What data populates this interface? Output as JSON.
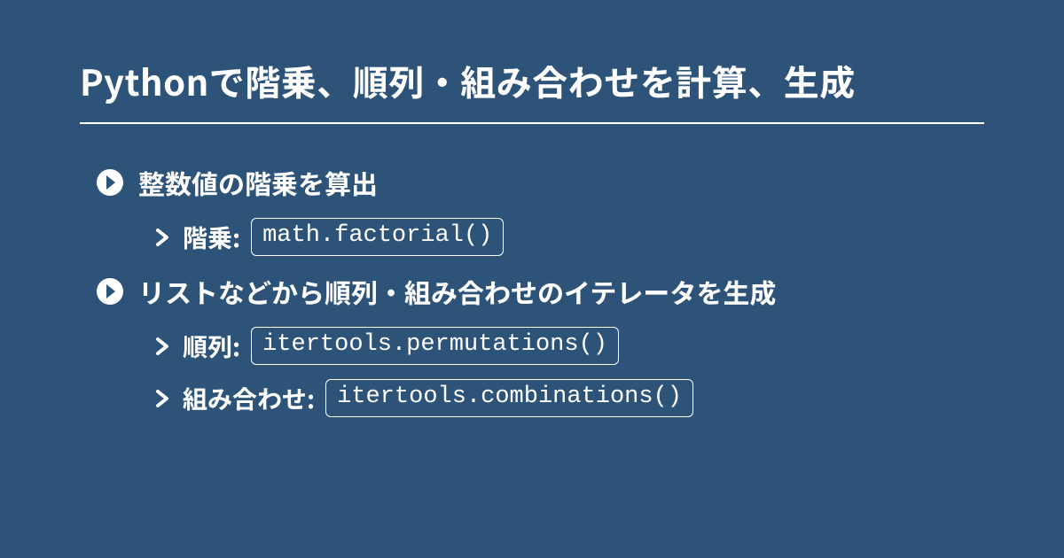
{
  "title": "Pythonで階乗、順列・組み合わせを計算、生成",
  "sections": [
    {
      "heading": "整数値の階乗を算出",
      "items": [
        {
          "label": "階乗:",
          "code": "math.factorial()"
        }
      ]
    },
    {
      "heading": "リストなどから順列・組み合わせのイテレータを生成",
      "items": [
        {
          "label": "順列:",
          "code": "itertools.permutations()"
        },
        {
          "label": "組み合わせ:",
          "code": "itertools.combinations()"
        }
      ]
    }
  ]
}
